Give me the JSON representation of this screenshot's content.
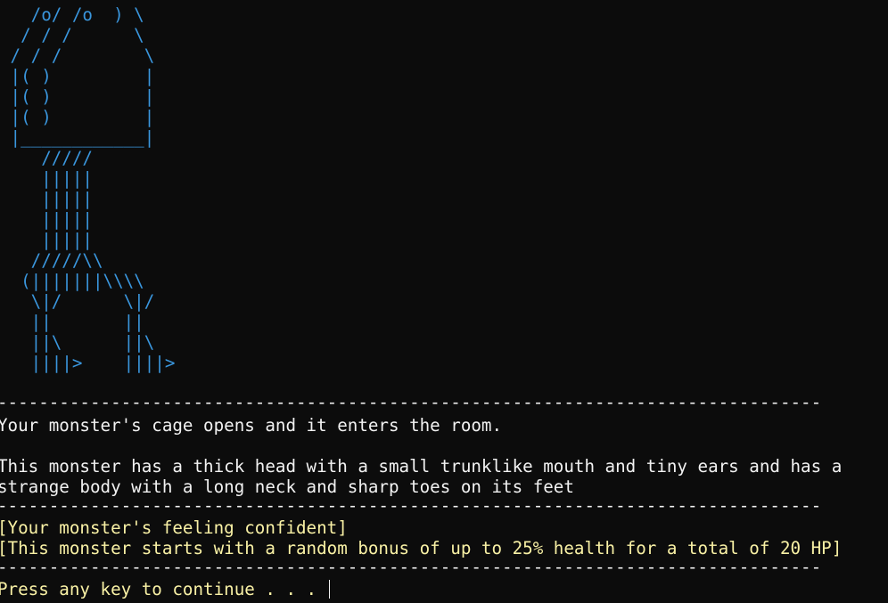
{
  "colors": {
    "background": "#0c0c0c",
    "art": "#3a96dd",
    "text": "#f2f2f2",
    "highlight": "#f9f1a5"
  },
  "ascii_art": "   /o/ /o  ) \\\n  / / /      \\\n / / /        \\\n |( )         |\n |( )         |\n |( )         |\n |____________|\n    /////\n    |||||\n    |||||\n    |||||\n    |||||\n   /////\\\\\n  (|||||||\\\\\\\\\n   \\|/      \\|/\n   ||       ||\n   ||\\      ||\\\n   ||||>    ||||>",
  "divider": "--------------------------------------------------------------------------------",
  "messages": {
    "cage_opens": "Your monster's cage opens and it enters the room.",
    "description_line1": "This monster has a thick head with a small trunklike mouth and tiny ears and has a",
    "description_line2": "strange body with a long neck and sharp toes on its feet",
    "feeling": "[Your monster's feeling confident]",
    "health_bonus": "[This monster starts with a random bonus of up to 25% health for a total of 20 HP]",
    "prompt": "Press any key to continue . . . "
  }
}
